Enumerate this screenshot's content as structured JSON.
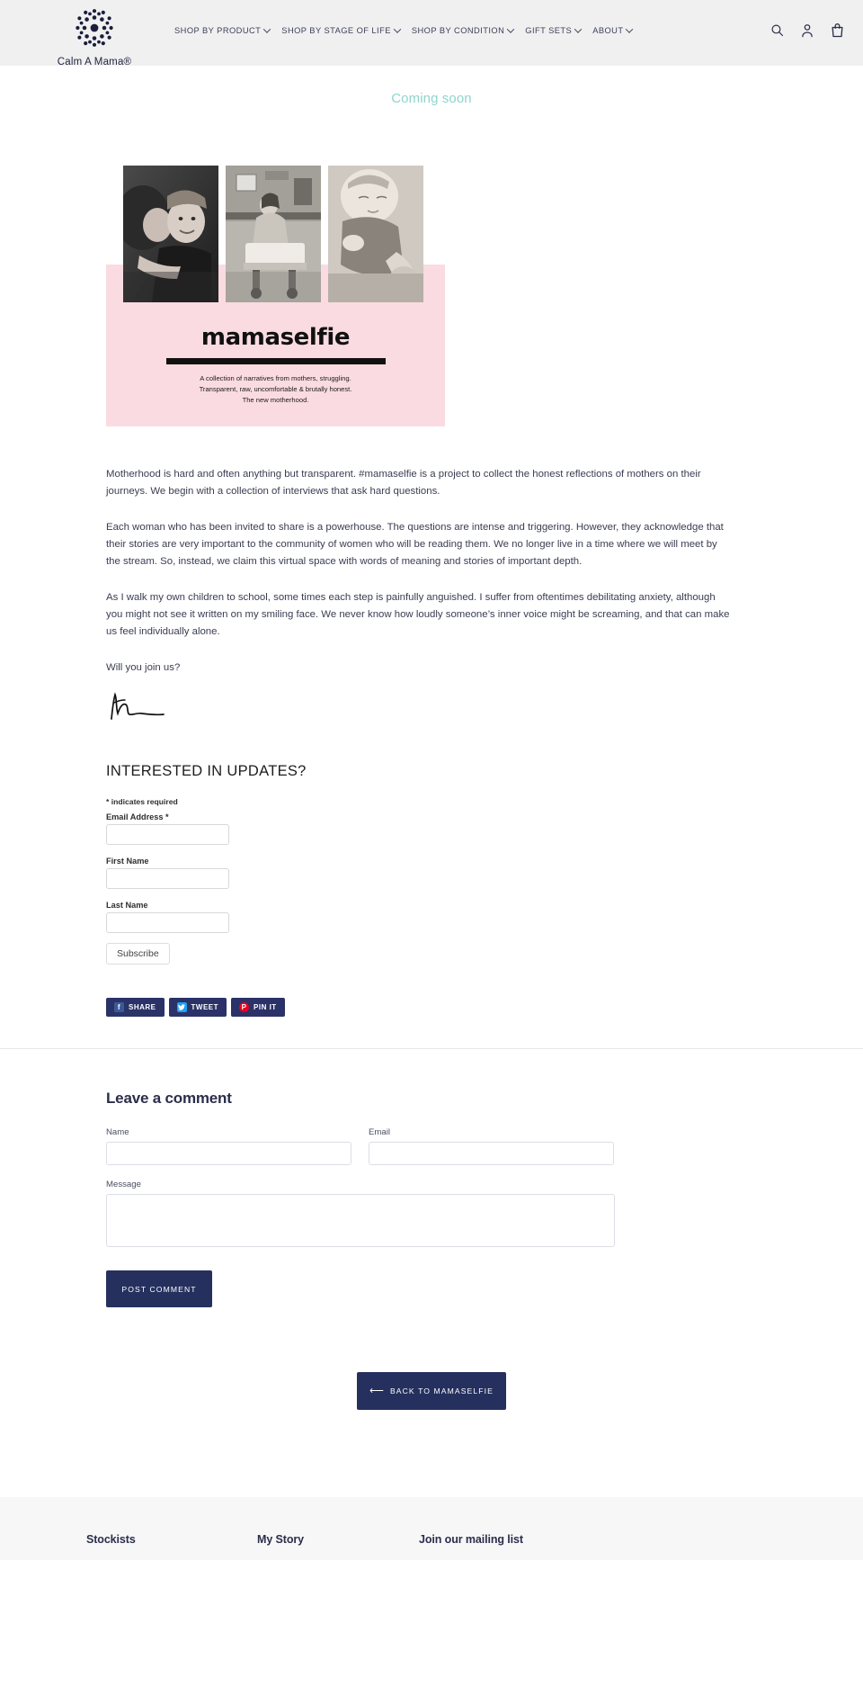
{
  "header": {
    "logo_text": "Calm A Mama®",
    "nav": [
      {
        "label": "SHOP BY PRODUCT",
        "caret": true
      },
      {
        "label": "SHOP BY STAGE OF LIFE",
        "caret": true
      },
      {
        "label": "SHOP BY CONDITION",
        "caret": true
      },
      {
        "label": "GIFT SETS",
        "caret": true
      },
      {
        "label": "ABOUT",
        "caret": true
      }
    ],
    "icons": [
      {
        "name": "search-icon",
        "label": "Search"
      },
      {
        "name": "account-icon",
        "label": "Log in"
      },
      {
        "name": "cart-icon",
        "label": "Cart"
      }
    ]
  },
  "announcement": {
    "text": "Coming soon",
    "color": "#8fd4cd"
  },
  "hero": {
    "title": "mamaselfie",
    "subtitle_lines": [
      "A collection of narratives from mothers, struggling.",
      "Transparent, raw, uncomfortable & brutally honest.",
      "The new motherhood."
    ],
    "background_color": "#fadbe1",
    "photo_alts": [
      "mother kissing baby in knit hat",
      "woman sitting on hospital bed",
      "sleeping baby held in arms"
    ]
  },
  "article": {
    "paragraphs": [
      "Motherhood is hard and often anything but transparent. #mamaselfie is a project to collect the honest reflections of mothers on their journeys.  We begin with a collection of interviews that ask hard questions.",
      "Each woman who has been invited to share is a powerhouse.  The questions are intense and triggering. However, they acknowledge that their stories are very important to the community of women who will be reading them. We no longer live in a time where we will meet by the stream.  So, instead, we claim  this virtual space with words of meaning and stories of important depth.",
      "As I walk my own children to school, some times each step is painfully anguished.  I suffer from oftentimes debilitating anxiety, although you might not see it written on my smiling face.  We never know how loudly someone’s inner voice might be screaming, and that can make us feel individually alone.",
      "Will you join us?"
    ],
    "signature_alt": "handwritten signature"
  },
  "newsletter": {
    "title": "INTERESTED IN UPDATES?",
    "required_note": "* indicates required",
    "fields": [
      {
        "label": "Email Address *",
        "value": "",
        "placeholder": ""
      },
      {
        "label": "First Name",
        "value": "",
        "placeholder": ""
      },
      {
        "label": "Last Name",
        "value": "",
        "placeholder": ""
      }
    ],
    "submit_label": "Subscribe"
  },
  "share": {
    "buttons": [
      {
        "label": "SHARE",
        "glyph": "f",
        "icon_name": "facebook-icon",
        "color": "#3b5998"
      },
      {
        "label": "TWEET",
        "glyph": "✆",
        "icon_name": "twitter-icon",
        "color": "#1da1f2"
      },
      {
        "label": "PIN IT",
        "glyph": "P",
        "icon_name": "pinterest-icon",
        "color": "#e60023"
      }
    ]
  },
  "comments": {
    "title": "Leave a comment",
    "name_label": "Name",
    "name_value": "",
    "email_label": "Email",
    "email_value": "",
    "message_label": "Message",
    "message_value": "",
    "submit_label": "POST COMMENT"
  },
  "back": {
    "arrow": "⟵",
    "label": "BACK TO MAMASELFIE"
  },
  "footer": {
    "columns": [
      {
        "heading": "Stockists"
      },
      {
        "heading": "My Story"
      },
      {
        "heading": "Join our mailing list"
      }
    ]
  }
}
